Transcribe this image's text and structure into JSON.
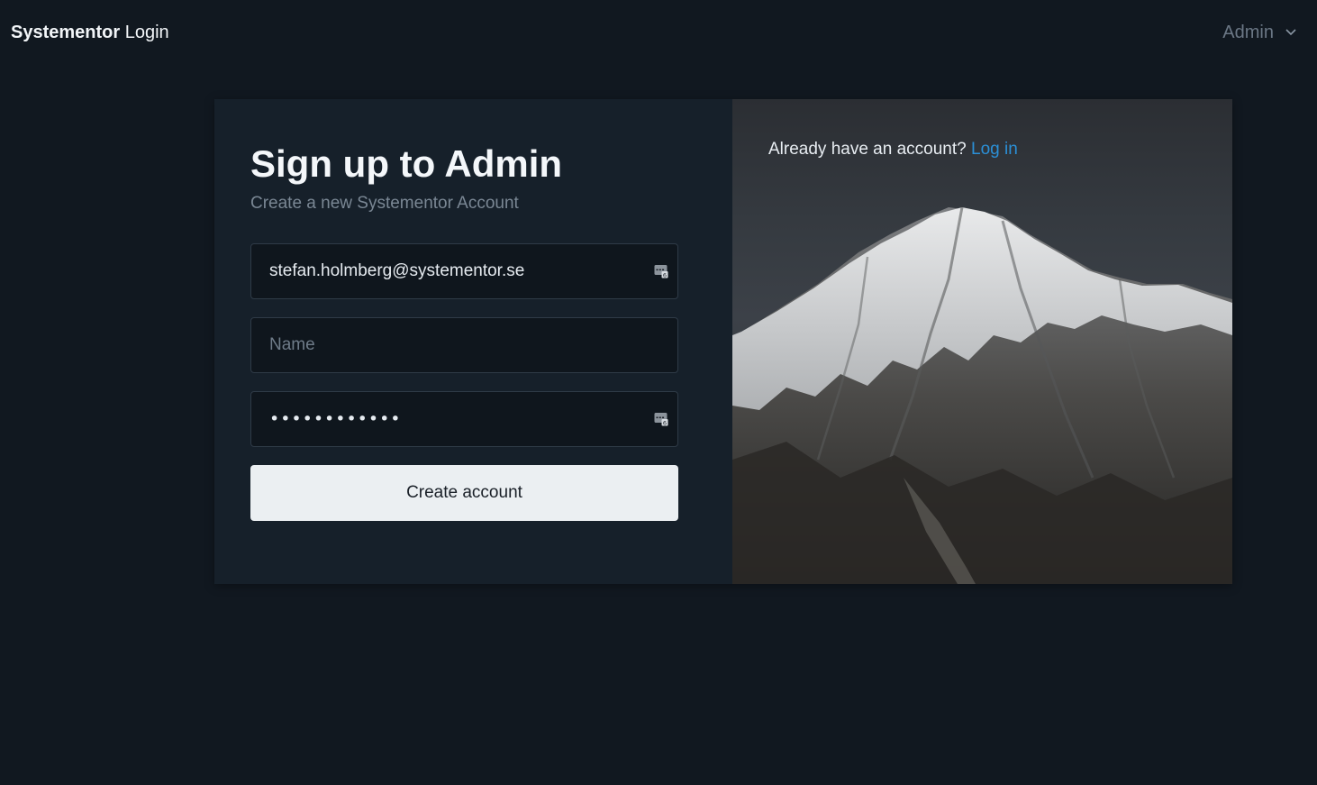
{
  "header": {
    "brand_bold": "Systementor",
    "brand_light": "Login",
    "user_menu_label": "Admin",
    "user_menu_icon": "chevron-down-icon"
  },
  "form": {
    "title": "Sign up to Admin",
    "subtitle": "Create a new Systementor Account",
    "email_value": "stefan.holmberg@systementor.se",
    "name_placeholder": "Name",
    "name_value": "",
    "password_mask": "••••••••••••",
    "autofill_icon": "password-manager-icon",
    "submit_label": "Create account"
  },
  "side": {
    "prompt": "Already have an account?",
    "login_link": "Log in",
    "image": "snowy-mountain-photo"
  },
  "colors": {
    "background": "#111820",
    "panel": "#16202a",
    "button": "#ebeff2",
    "link": "#2b8fd6"
  }
}
